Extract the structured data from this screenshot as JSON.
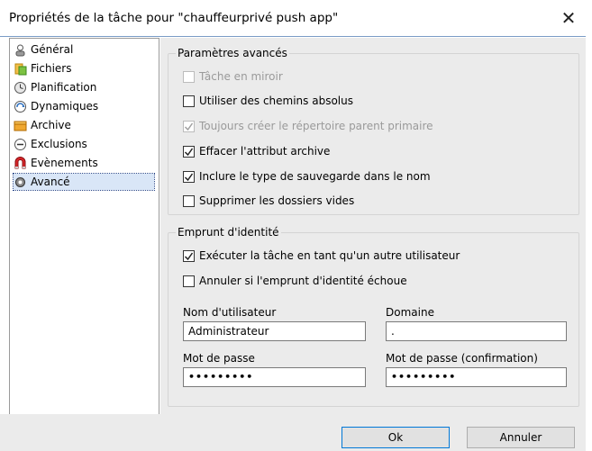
{
  "window": {
    "title": "Propriétés de la tâche pour \"chauffeurprivé push app\"",
    "close_glyph": "✕"
  },
  "sidebar": {
    "items": [
      {
        "label": "Général",
        "icon": "general-icon"
      },
      {
        "label": "Fichiers",
        "icon": "files-icon"
      },
      {
        "label": "Planification",
        "icon": "schedule-icon"
      },
      {
        "label": "Dynamiques",
        "icon": "dynamics-icon"
      },
      {
        "label": "Archive",
        "icon": "archive-icon"
      },
      {
        "label": "Exclusions",
        "icon": "exclusions-icon"
      },
      {
        "label": "Evènements",
        "icon": "events-icon"
      },
      {
        "label": "Avancé",
        "icon": "advanced-icon"
      }
    ],
    "selected": "Avancé"
  },
  "advanced": {
    "title": "Paramètres avancés",
    "options": [
      {
        "label": "Tâche en miroir",
        "checked": false,
        "disabled": true
      },
      {
        "label": "Utiliser des chemins absolus",
        "checked": false,
        "disabled": false
      },
      {
        "label": "Toujours créer le répertoire parent primaire",
        "checked": true,
        "disabled": true
      },
      {
        "label": "Effacer l'attribut archive",
        "checked": true,
        "disabled": false
      },
      {
        "label": "Inclure le type de sauvegarde dans le nom",
        "checked": true,
        "disabled": false
      },
      {
        "label": "Supprimer les dossiers vides",
        "checked": false,
        "disabled": false
      }
    ]
  },
  "impersonation": {
    "title": "Emprunt d'identité",
    "run_as_label": "Exécuter la tâche en tant qu'un autre utilisateur",
    "run_as_checked": true,
    "cancel_label": "Annuler si l'emprunt d'identité échoue",
    "cancel_checked": false,
    "username_label": "Nom d'utilisateur",
    "username_value": "Administrateur",
    "domain_label": "Domaine",
    "domain_value": ".",
    "password_label": "Mot de passe",
    "password_value": "•••••••••",
    "confirm_label": "Mot de passe (confirmation)",
    "confirm_value": "•••••••••"
  },
  "footer": {
    "ok_label": "Ok",
    "cancel_label": "Annuler"
  },
  "colors": {
    "accent": "#0078d7",
    "selection": "#d9e6f7",
    "panel": "#ebebeb"
  }
}
